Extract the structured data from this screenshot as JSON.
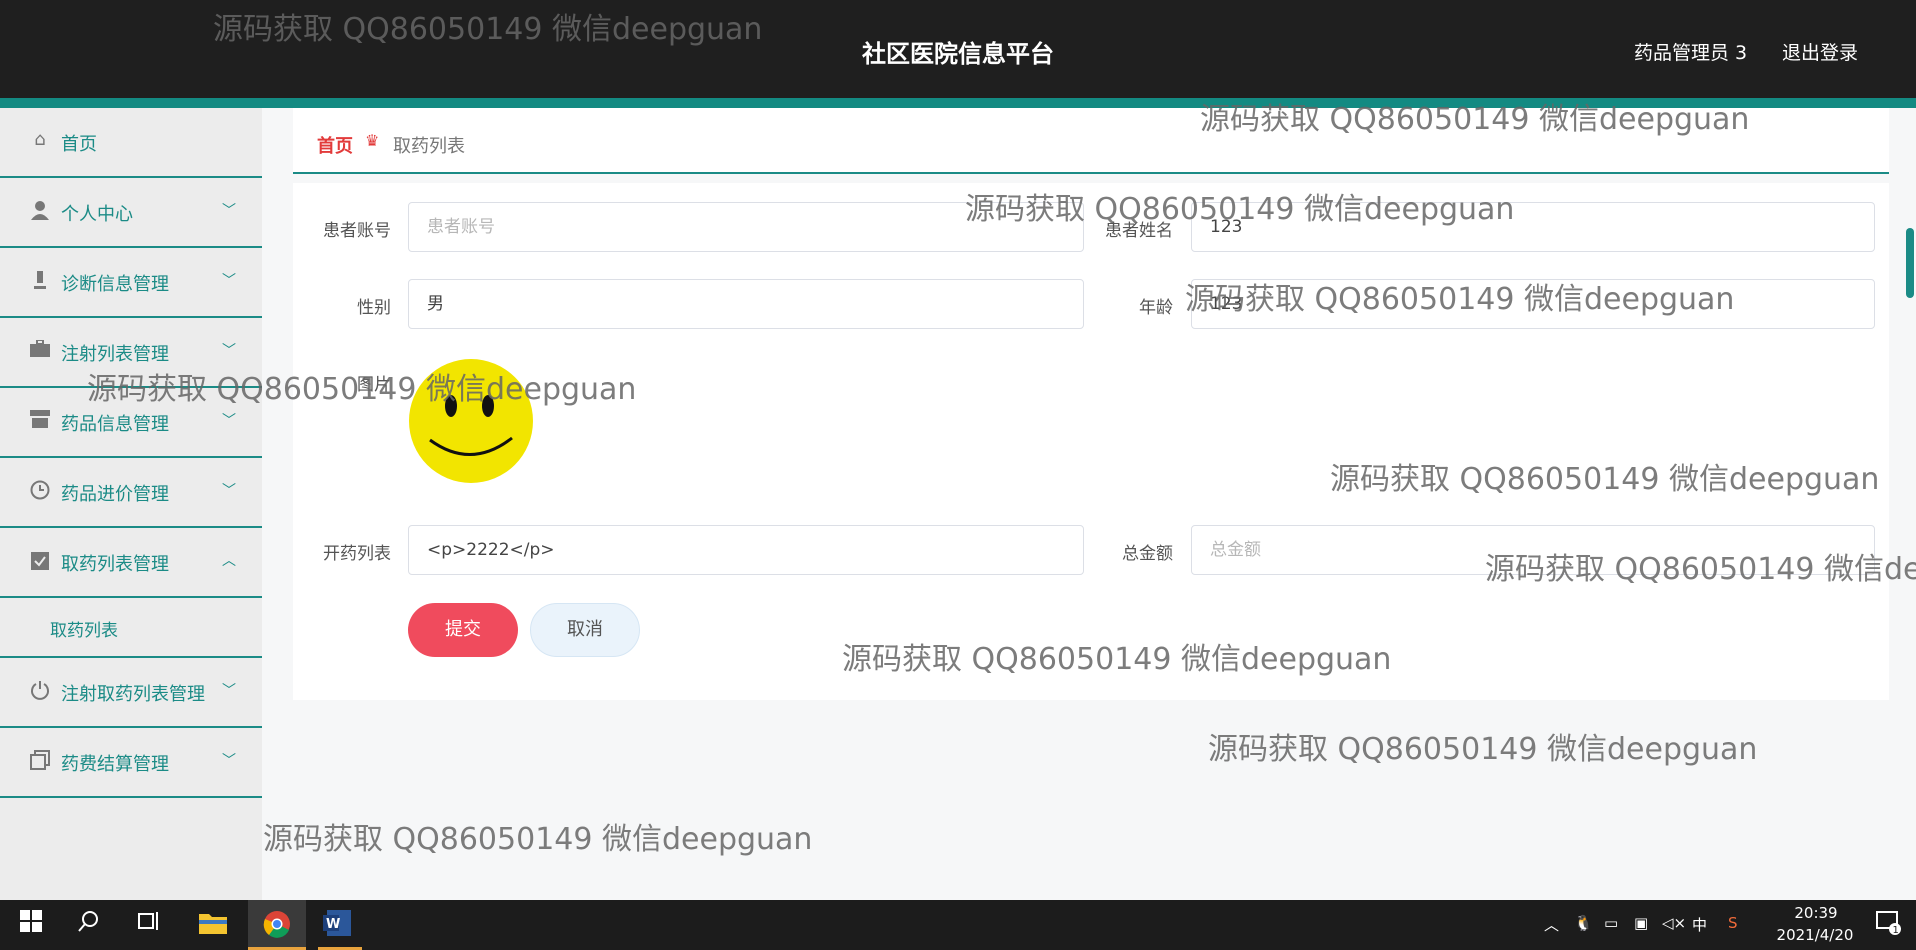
{
  "header": {
    "title": "社区医院信息平台",
    "user": "药品管理员 3",
    "logout": "退出登录"
  },
  "sidebar": {
    "items": [
      {
        "label": "首页",
        "icon": "home-icon"
      },
      {
        "label": "个人中心",
        "icon": "user-icon"
      },
      {
        "label": "诊断信息管理",
        "icon": "microscope-icon"
      },
      {
        "label": "注射列表管理",
        "icon": "briefcase-icon"
      },
      {
        "label": "药品信息管理",
        "icon": "shop-icon"
      },
      {
        "label": "药品进价管理",
        "icon": "clock-icon"
      },
      {
        "label": "取药列表管理",
        "icon": "clipboard-check-icon"
      },
      {
        "label": "注射取药列表管理",
        "icon": "power-icon"
      },
      {
        "label": "药费结算管理",
        "icon": "copy-icon"
      }
    ],
    "sub_item": "取药列表"
  },
  "breadcrumb": {
    "home": "首页",
    "current": "取药列表"
  },
  "form": {
    "account_label": "患者账号",
    "account_placeholder": "患者账号",
    "name_label": "患者姓名",
    "name_value": "123",
    "gender_label": "性别",
    "gender_value": "男",
    "age_label": "年龄",
    "age_value": "123",
    "photo_label": "图片",
    "prescription_label": "开药列表",
    "prescription_value": "<p>2222</p>",
    "total_label": "总金额",
    "total_placeholder": "总金额",
    "submit": "提交",
    "cancel": "取消"
  },
  "watermark": {
    "text": "源码获取 QQ86050149 微信deepguan",
    "text_cut": "源码获取 QQ86050149 微信dee"
  },
  "taskbar": {
    "time": "20:39",
    "date": "2021/4/20",
    "ime": "中",
    "notifications": "1"
  },
  "colors": {
    "accent": "#1b8b86",
    "header_bg": "#1f1f1f",
    "submit_button": "#f04b5d",
    "breadcrumb_home": "#e23b3b"
  }
}
